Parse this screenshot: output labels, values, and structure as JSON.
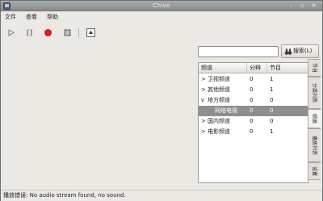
{
  "window": {
    "title": "Chive"
  },
  "menu": {
    "items": [
      "文件",
      "查看",
      "帮助"
    ]
  },
  "toolbar": {
    "buttons": [
      "play-icon",
      "pause-icon",
      "record-icon",
      "stop-icon",
      "snapshot-icon"
    ]
  },
  "search": {
    "value": "",
    "button_label": "搜索(L)"
  },
  "table": {
    "columns": [
      "频道",
      "分辨",
      "节目"
    ],
    "rows": [
      {
        "expander": ">",
        "name": "卫视频道",
        "col2": "0",
        "col3": "1"
      },
      {
        "expander": ">",
        "name": "其他频道",
        "col2": "0",
        "col3": "1"
      },
      {
        "expander": "v",
        "name": "地方频道",
        "col2": "0",
        "col3": "0"
      },
      {
        "expander": "",
        "name": "网络电视",
        "col2": "0",
        "col3": "0",
        "selected": true
      },
      {
        "expander": ">",
        "name": "国内频道",
        "col2": "0",
        "col3": "0"
      },
      {
        "expander": ">",
        "name": "电影频道",
        "col2": "0",
        "col3": "1"
      }
    ]
  },
  "side_tabs": [
    "节目",
    "分类列表",
    "频道",
    "播放列表",
    "设置"
  ],
  "status": {
    "text": "播放错误: No audio stream found, no sound."
  }
}
